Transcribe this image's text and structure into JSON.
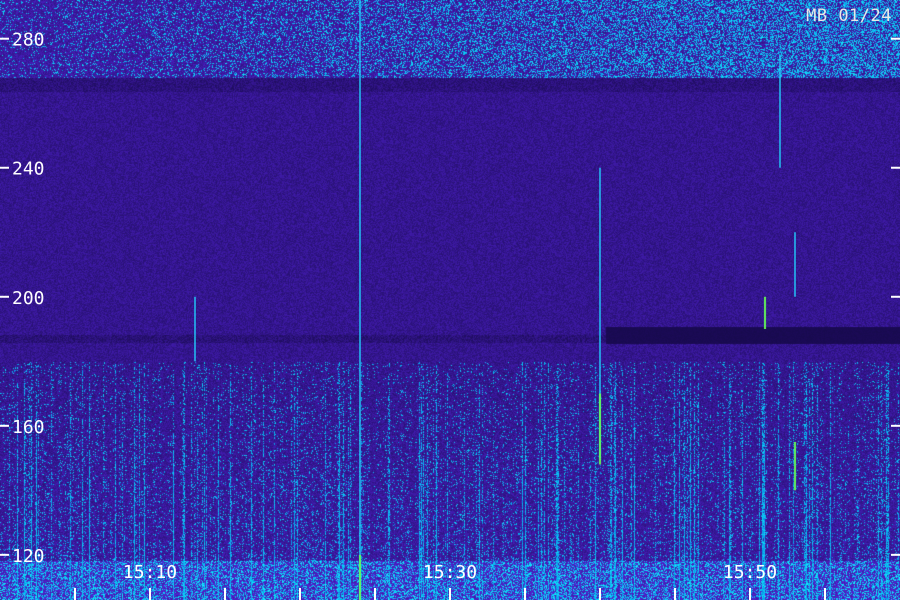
{
  "corner_label": "MB 01/24",
  "colors": {
    "background": "#1e0f62",
    "band_upper": "#161065",
    "band_dark": "#080032",
    "signal_cyan": "#22d4ff",
    "signal_green": "#66ff55",
    "axis_text": "#ffffff",
    "tick": "#ffffff"
  },
  "chart_data": {
    "type": "heatmap",
    "title": "",
    "xlabel": "",
    "ylabel": "",
    "x_tick_labels": [
      "15:10",
      "15:30",
      "15:50"
    ],
    "y_tick_labels": [
      "280",
      "240",
      "200",
      "160",
      "120"
    ],
    "y_ticks": [
      280,
      240,
      200,
      160,
      120
    ],
    "ylim": [
      106,
      292
    ],
    "x_range": [
      "15:00",
      "16:00"
    ],
    "x_ticks": [
      "15:10",
      "15:30",
      "15:50"
    ],
    "x_minor_ticks_minutes": 5,
    "grid": false,
    "legend": "none",
    "bright_signals": [
      {
        "time": "15:24",
        "freq_low": 106,
        "freq_high": 292,
        "color": "cyan"
      },
      {
        "time": "15:24",
        "freq_low": 106,
        "freq_high": 120,
        "color": "green"
      },
      {
        "time": "15:40",
        "freq_low": 150,
        "freq_high": 240,
        "color": "cyan"
      },
      {
        "time": "15:40",
        "freq_low": 148,
        "freq_high": 170,
        "color": "green"
      },
      {
        "time": "15:51",
        "freq_low": 190,
        "freq_high": 200,
        "color": "green"
      },
      {
        "time": "15:52",
        "freq_low": 240,
        "freq_high": 275,
        "color": "cyan"
      },
      {
        "time": "15:53",
        "freq_low": 200,
        "freq_high": 220,
        "color": "cyan"
      },
      {
        "time": "15:53",
        "freq_low": 140,
        "freq_high": 155,
        "color": "green"
      },
      {
        "time": "15:13",
        "freq_low": 180,
        "freq_high": 200,
        "color": "cyan"
      }
    ],
    "bands": [
      {
        "freq_low": 268,
        "freq_high": 292,
        "level": "bright"
      },
      {
        "freq_low": 183,
        "freq_high": 187,
        "level": "dark"
      },
      {
        "freq_low": 106,
        "freq_high": 180,
        "level": "active"
      }
    ]
  }
}
